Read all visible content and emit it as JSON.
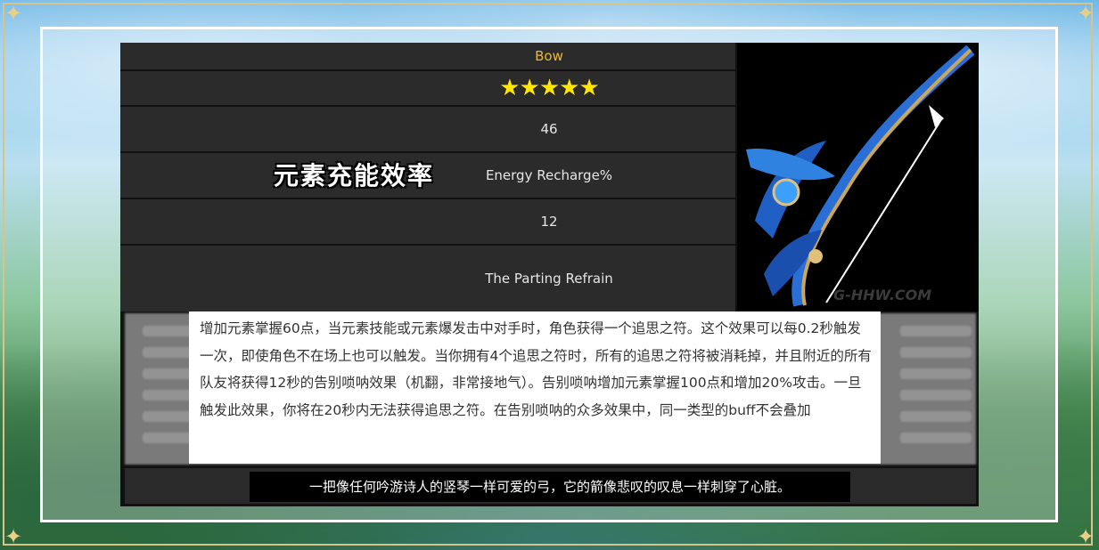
{
  "weapon": {
    "type": "Bow",
    "rarity_stars": "★★★★★",
    "base_atk": "46",
    "substat_label_cn": "元素充能效率",
    "substat": "Energy Recharge%",
    "substat_value": "12",
    "passive_name": "The Parting Refrain"
  },
  "description_cn": "增加元素掌握60点，当元素技能或元素爆发击中对手时，角色获得一个追思之符。这个效果可以每0.2秒触发一次，即使角色不在场上也可以触发。当你拥有4个追思之符时，所有的追思之符将被消耗掉，并且附近的所有队友将获得12秒的告别唢呐效果（机翻，非常接地气）。告别唢呐增加元素掌握100点和增加20%攻击。一旦触发此效果，你将在20秒内无法获得追思之符。在告别唢呐的众多效果中，同一类型的buff不会叠加",
  "subtitle_cn": "一把像任何吟游诗人的竖琴一样可爱的弓，它的箭像悲叹的叹息一样刺穿了心脏。",
  "watermark": "G-HHW.COM",
  "colors": {
    "accent_gold": "#e9b93a",
    "star_yellow": "#ffe600",
    "row_bg": "#2b2b2b"
  }
}
